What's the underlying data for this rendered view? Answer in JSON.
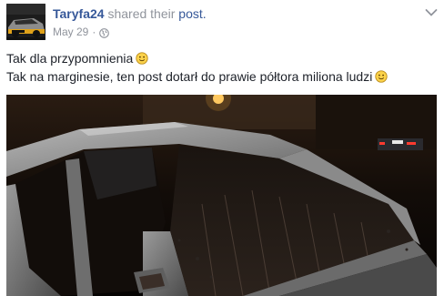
{
  "post": {
    "author": "Taryfa24",
    "shared_text": "shared their",
    "shared_link": "post.",
    "date": "May 29",
    "separator": "·",
    "privacy_icon": "globe-icon",
    "menu_icon": "chevron-down-icon",
    "text_lines": [
      "Tak dla przypomnienia",
      "Tak na marginesie, ten post dotarł do prawie półtora miliona ludzi"
    ],
    "emoji_icon": "smiley-icon",
    "avatar_icon": "taxi-car-avatar",
    "photo_icon": "damaged-car-windshield-photo"
  },
  "colors": {
    "link": "#365899",
    "secondary_text": "#90949c",
    "body_text": "#1d2129"
  }
}
